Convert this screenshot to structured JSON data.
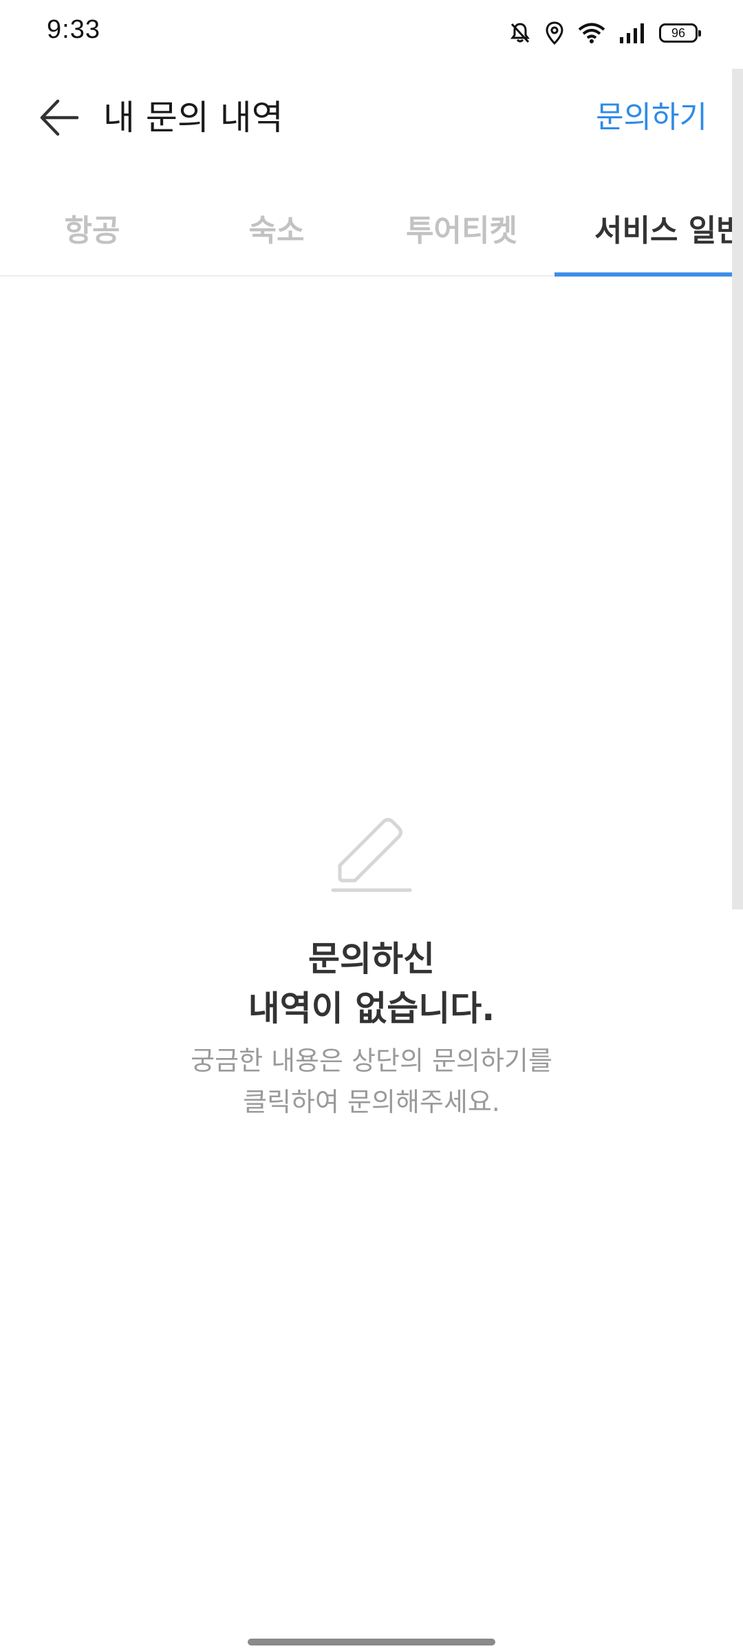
{
  "status_bar": {
    "time": "9:33",
    "battery": "96",
    "icons": [
      "bell-off-icon",
      "location-icon",
      "wifi-icon",
      "signal-icon",
      "battery-icon"
    ]
  },
  "header": {
    "back_icon": "arrow-left-icon",
    "title": "내 문의 내역",
    "action_label": "문의하기",
    "action_color": "#2f8be6"
  },
  "tabs": [
    {
      "label": "항공",
      "active": false
    },
    {
      "label": "숙소",
      "active": false
    },
    {
      "label": "투어티켓",
      "active": false
    },
    {
      "label": "서비스 일반",
      "active": true
    }
  ],
  "tab_indicator_color": "#3d8ee8",
  "empty_state": {
    "icon": "pencil-icon",
    "title_line1": "문의하신",
    "title_line2": "내역이 없습니다.",
    "desc_line1": "궁금한 내용은 상단의 문의하기를",
    "desc_line2": "클릭하여 문의해주세요."
  }
}
